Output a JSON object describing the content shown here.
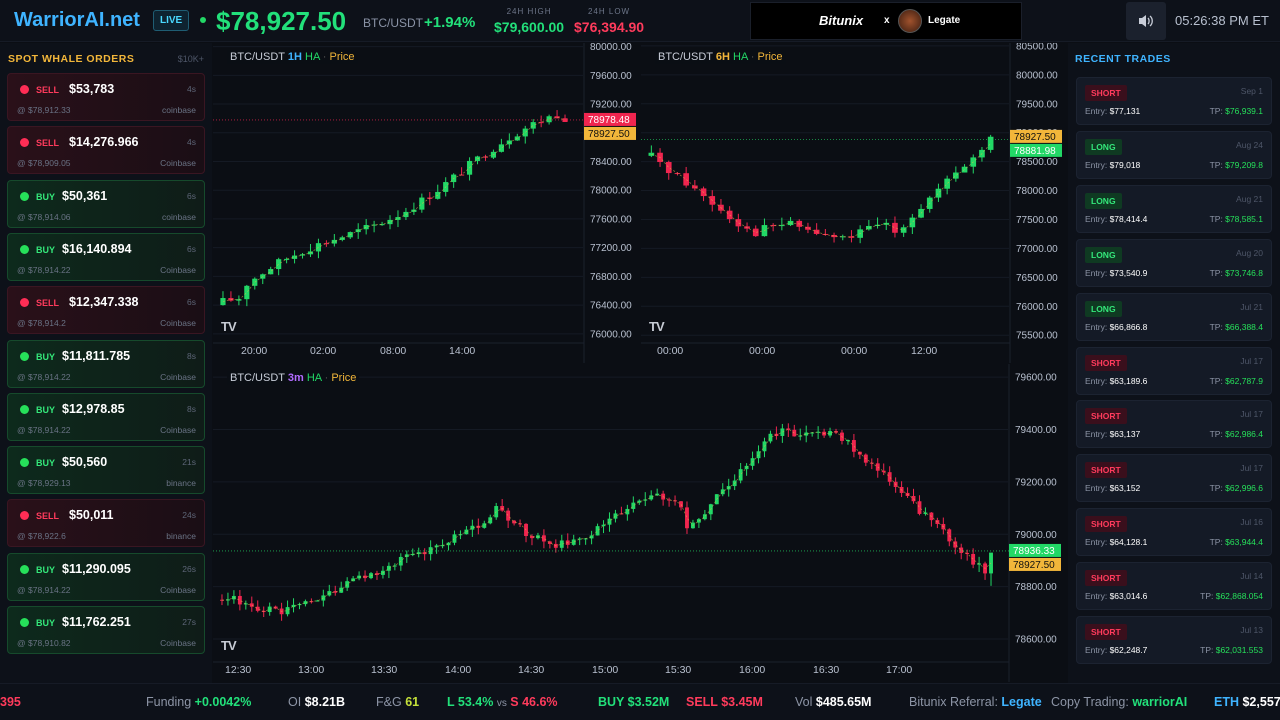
{
  "header": {
    "logo": "WarriorAI.net",
    "live": "LIVE",
    "price": "$78,927.50",
    "pair": "BTC/USDT",
    "change": "+1.94%",
    "high_label": "24H HIGH",
    "high": "$79,600.00",
    "low_label": "24H LOW",
    "low": "$76,394.90",
    "sponsor_brand": "Bitunix",
    "sponsor_x": "x",
    "sponsor_name": "Legate",
    "clock": "05:26:38 PM ET",
    "sound_icon": "speaker-icon"
  },
  "whale": {
    "title": "SPOT WHALE ORDERS",
    "threshold": "$10K+",
    "orders": [
      {
        "side": "SELL",
        "amount": "$53,783",
        "ago": "4s",
        "at": "@ $78,912.33",
        "exchange": "coinbase"
      },
      {
        "side": "SELL",
        "amount": "$14,276.966",
        "ago": "4s",
        "at": "@ $78,909.05",
        "exchange": "Coinbase"
      },
      {
        "side": "BUY",
        "amount": "$50,361",
        "ago": "6s",
        "at": "@ $78,914.06",
        "exchange": "coinbase"
      },
      {
        "side": "BUY",
        "amount": "$16,140.894",
        "ago": "6s",
        "at": "@ $78,914.22",
        "exchange": "Coinbase"
      },
      {
        "side": "SELL",
        "amount": "$12,347.338",
        "ago": "6s",
        "at": "@ $78,914.2",
        "exchange": "Coinbase"
      },
      {
        "side": "BUY",
        "amount": "$11,811.785",
        "ago": "8s",
        "at": "@ $78,914.22",
        "exchange": "Coinbase"
      },
      {
        "side": "BUY",
        "amount": "$12,978.85",
        "ago": "8s",
        "at": "@ $78,914.22",
        "exchange": "Coinbase"
      },
      {
        "side": "BUY",
        "amount": "$50,560",
        "ago": "21s",
        "at": "@ $78,929.13",
        "exchange": "binance"
      },
      {
        "side": "SELL",
        "amount": "$50,011",
        "ago": "24s",
        "at": "@ $78,922.6",
        "exchange": "binance"
      },
      {
        "side": "BUY",
        "amount": "$11,290.095",
        "ago": "26s",
        "at": "@ $78,914.22",
        "exchange": "Coinbase"
      },
      {
        "side": "BUY",
        "amount": "$11,762.251",
        "ago": "27s",
        "at": "@ $78,910.82",
        "exchange": "Coinbase"
      }
    ]
  },
  "trades": {
    "title": "RECENT TRADES",
    "entry_label": "Entry: ",
    "tp_label": "TP: ",
    "items": [
      {
        "side": "SHORT",
        "date": "Sep 1",
        "entry": "$77,131",
        "tp": "$76,939.1"
      },
      {
        "side": "LONG",
        "date": "Aug 24",
        "entry": "$79,018",
        "tp": "$79,209.8"
      },
      {
        "side": "LONG",
        "date": "Aug 21",
        "entry": "$78,414.4",
        "tp": "$78,585.1"
      },
      {
        "side": "LONG",
        "date": "Aug 20",
        "entry": "$73,540.9",
        "tp": "$73,746.8"
      },
      {
        "side": "LONG",
        "date": "Jul 21",
        "entry": "$66,866.8",
        "tp": "$66,388.4"
      },
      {
        "side": "SHORT",
        "date": "Jul 17",
        "entry": "$63,189.6",
        "tp": "$62,787.9"
      },
      {
        "side": "SHORT",
        "date": "Jul 17",
        "entry": "$63,137",
        "tp": "$62,986.4"
      },
      {
        "side": "SHORT",
        "date": "Jul 17",
        "entry": "$63,152",
        "tp": "$62,996.6"
      },
      {
        "side": "SHORT",
        "date": "Jul 16",
        "entry": "$64,128.1",
        "tp": "$63,944.4"
      },
      {
        "side": "SHORT",
        "date": "Jul 14",
        "entry": "$63,014.6",
        "tp": "$62,868.054"
      },
      {
        "side": "SHORT",
        "date": "Jul 13",
        "entry": "$62,248.7",
        "tp": "$62,031.553"
      }
    ]
  },
  "chart_data": [
    {
      "type": "candlestick",
      "symbol": "BTC/USDT",
      "interval": "1H",
      "style": "HA",
      "mode": "Price",
      "y_ticks": [
        "80000.00",
        "79600.00",
        "79200.00",
        "78800.00",
        "78400.00",
        "78000.00",
        "77600.00",
        "77200.00",
        "76800.00",
        "76400.00",
        "76000.00"
      ],
      "ylim": [
        75900,
        80050
      ],
      "x_ticks": [
        "20:00",
        "02:00",
        "08:00",
        "14:00"
      ],
      "price_labels": [
        "78978.48",
        "78927.50"
      ],
      "line_price": 78978.48,
      "start": 76400,
      "end": 78950
    },
    {
      "type": "candlestick",
      "symbol": "BTC/USDT",
      "interval": "6H",
      "style": "HA",
      "mode": "Price",
      "y_ticks": [
        "80500.00",
        "80000.00",
        "79500.00",
        "79000.00",
        "78500.00",
        "78000.00",
        "77500.00",
        "77000.00",
        "76500.00",
        "76000.00",
        "75500.00"
      ],
      "ylim": [
        75400,
        80550
      ],
      "x_ticks": [
        "00:00",
        "00:00",
        "00:00",
        "12:00"
      ],
      "price_labels": [
        "78927.50",
        "78881.98"
      ],
      "line_price": 78881.98,
      "start": 78600,
      "end": 78930
    },
    {
      "type": "candlestick",
      "symbol": "BTC/USDT",
      "interval": "3m",
      "style": "HA",
      "mode": "Price",
      "y_ticks": [
        "79600.00",
        "79400.00",
        "79200.00",
        "79000.00",
        "78800.00",
        "78600.00"
      ],
      "ylim": [
        78520,
        79650
      ],
      "x_ticks": [
        "12:30",
        "13:00",
        "13:30",
        "14:00",
        "14:30",
        "15:00",
        "15:30",
        "16:00",
        "16:30",
        "17:00"
      ],
      "price_labels": [
        "78936.33",
        "78927.50"
      ],
      "line_price": 78936.33,
      "start": 78750,
      "end": 78930
    }
  ],
  "ticker": {
    "lead": "395",
    "funding_label": "Funding",
    "funding": "+0.0042%",
    "oi_label": "OI",
    "oi": "$8.21B",
    "fg_label": "F&G",
    "fg": "61",
    "long": "L 53.4%",
    "vs": "vs",
    "short": "S 46.6%",
    "buy": "BUY $3.52M",
    "sell": "SELL $3.45M",
    "vol_label": "Vol",
    "vol": "$485.65M",
    "ref_label": "Bitunix Referral:",
    "ref": "Legate",
    "copy_label": "Copy Trading:",
    "copy": "warriorAI",
    "eth_label": "ETH",
    "eth": "$2,557"
  },
  "colors": {
    "up": "#22d866",
    "down": "#f0254f",
    "accent": "#3fb4ff",
    "gold": "#f2b63a"
  }
}
